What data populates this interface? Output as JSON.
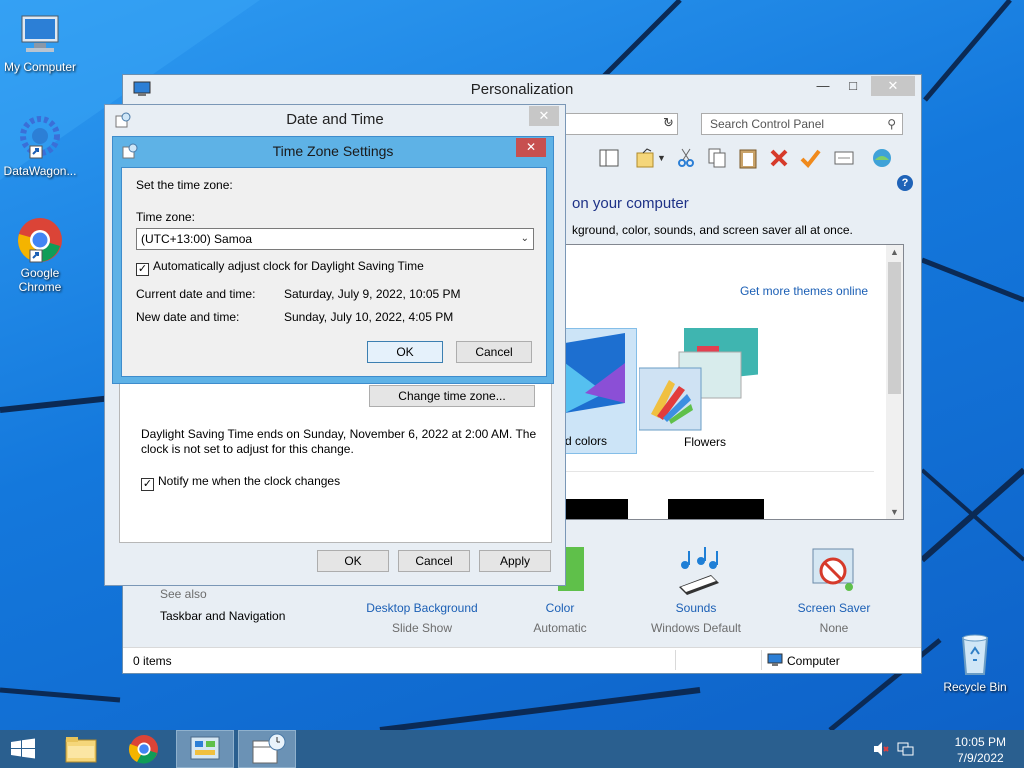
{
  "desktop": {
    "icons": [
      {
        "label": "My Computer"
      },
      {
        "label": "DataWagon..."
      },
      {
        "label": "Google Chrome"
      },
      {
        "label": "Recycle Bin"
      }
    ]
  },
  "personalization": {
    "title": "Personalization",
    "search_placeholder": "Search Control Panel",
    "heading": "on your computer",
    "subtext": "kground, color, sounds, and screen saver all at once.",
    "get_more_themes": "Get more themes online",
    "selected_theme_label": "d colors",
    "flowers_label": "Flowers",
    "see_also": "See also",
    "taskbar_navigation": "Taskbar and Navigation",
    "bottom_items": [
      {
        "label": "Desktop Background",
        "sub": "Slide Show"
      },
      {
        "label": "Color",
        "sub": "Automatic"
      },
      {
        "label": "Sounds",
        "sub": "Windows Default"
      },
      {
        "label": "Screen Saver",
        "sub": "None"
      }
    ],
    "status_left": "0 items",
    "status_right": "Computer"
  },
  "datetime": {
    "title": "Date and Time",
    "change_tz_button": "Change time zone...",
    "dst_text": "Daylight Saving Time ends on Sunday, November 6, 2022 at 2:00 AM. The clock is not set to adjust for this change.",
    "notify_label": "Notify me when the clock changes",
    "ok": "OK",
    "cancel": "Cancel",
    "apply": "Apply"
  },
  "tzs": {
    "title": "Time Zone Settings",
    "set_label": "Set the time zone:",
    "tz_label": "Time zone:",
    "tz_value": "(UTC+13:00) Samoa",
    "auto_dst_label": "Automatically adjust clock for Daylight Saving Time",
    "current_label": "Current date and time:",
    "current_value": "Saturday, July 9, 2022, 10:05 PM",
    "new_label": "New date and time:",
    "new_value": "Sunday, July 10, 2022, 4:05 PM",
    "ok": "OK",
    "cancel": "Cancel"
  },
  "taskbar": {
    "time": "10:05 PM",
    "date": "7/9/2022"
  },
  "colors": {
    "link": "#1b5fb5",
    "desktop": "#1478dc",
    "taskbar": "#2a5f8f",
    "close_red": "#c75050"
  }
}
